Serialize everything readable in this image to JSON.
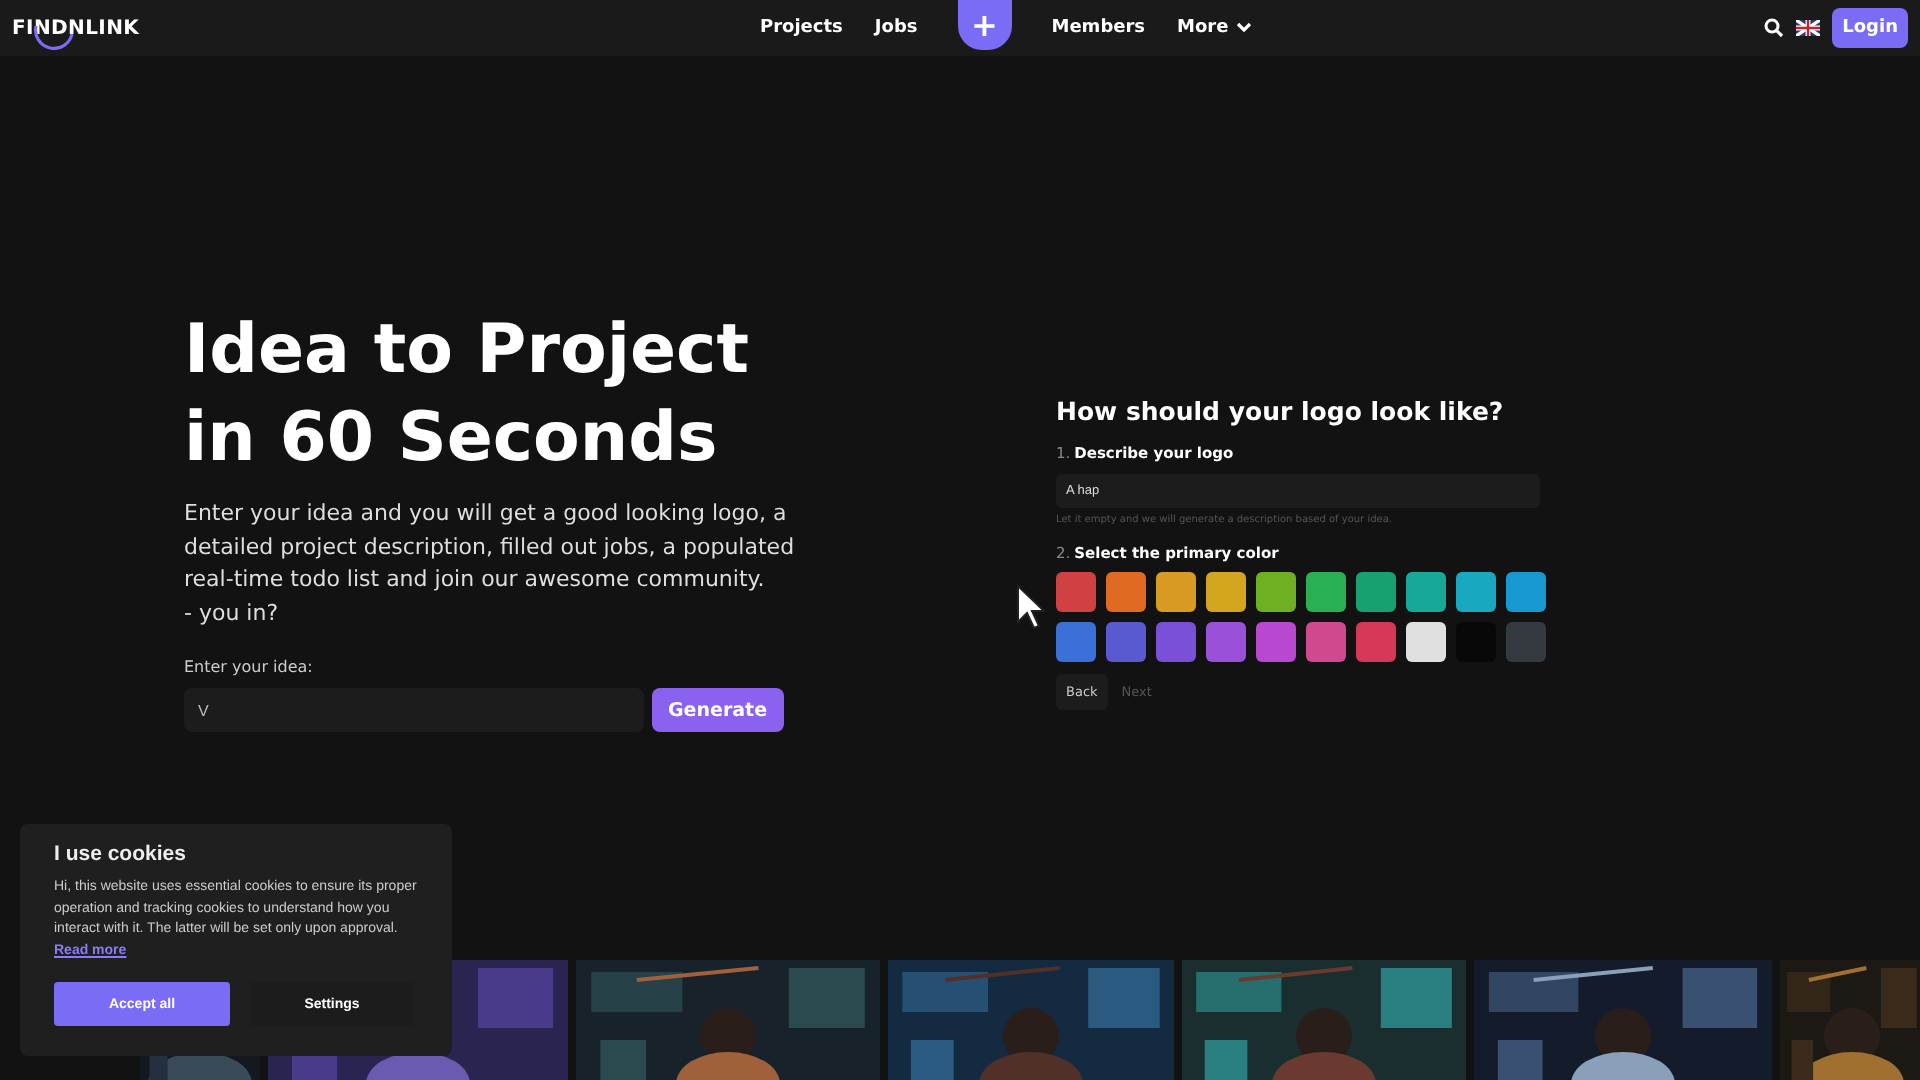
{
  "header": {
    "logo": "FINDNLINK",
    "nav": [
      {
        "kind": "link",
        "label": "Projects"
      },
      {
        "kind": "link",
        "label": "Jobs"
      },
      {
        "kind": "plus",
        "label": "+"
      },
      {
        "kind": "link",
        "label": "Members"
      },
      {
        "kind": "menu",
        "label": "More"
      }
    ],
    "login": "Login"
  },
  "hero": {
    "title_lines": [
      "Idea to Project",
      "in 60 Seconds"
    ],
    "intro": "Enter your idea and you will get a good looking logo, a detailed project description, filled out jobs, a populated real-time todo list and join our awesome community.\n- you in?",
    "idea_label": "Enter your idea:",
    "idea_value": "V",
    "generate": "Generate"
  },
  "logo_step": {
    "title": "How should your logo look like?",
    "describe": {
      "number": "1.",
      "label": "Describe your logo",
      "value": "A hap",
      "hint": "Let it empty and we will generate a description based of your idea."
    },
    "color": {
      "number": "2.",
      "label": "Select the primary color"
    },
    "swatches": [
      {
        "color": "#d04242"
      },
      {
        "color": "#e06a22"
      },
      {
        "color": "#d89a22"
      },
      {
        "color": "#d4a620"
      },
      {
        "color": "#6fb022"
      },
      {
        "color": "#28b052"
      },
      {
        "color": "#18a070"
      },
      {
        "color": "#18a898"
      },
      {
        "color": "#18a8c0"
      },
      {
        "color": "#1898d0"
      },
      {
        "color": "#3a70d8"
      },
      {
        "color": "#5a5ad0"
      },
      {
        "color": "#7a50d8"
      },
      {
        "color": "#9a50d8"
      },
      {
        "color": "#b848d0"
      },
      {
        "color": "#d04890"
      },
      {
        "color": "#d83858"
      },
      {
        "color": "#e0e0e0"
      },
      {
        "color": "#080808"
      },
      {
        "color": "#353a40"
      }
    ],
    "back": "Back",
    "next": "Next"
  },
  "cookies": {
    "title": "I use cookies",
    "text": "Hi, this website uses essential cookies to ensure its proper operation and tracking cookies to understand how you interact with it. The latter will be set only upon approval.",
    "link": "Read more",
    "accept": "Accept all",
    "settings": "Settings"
  }
}
